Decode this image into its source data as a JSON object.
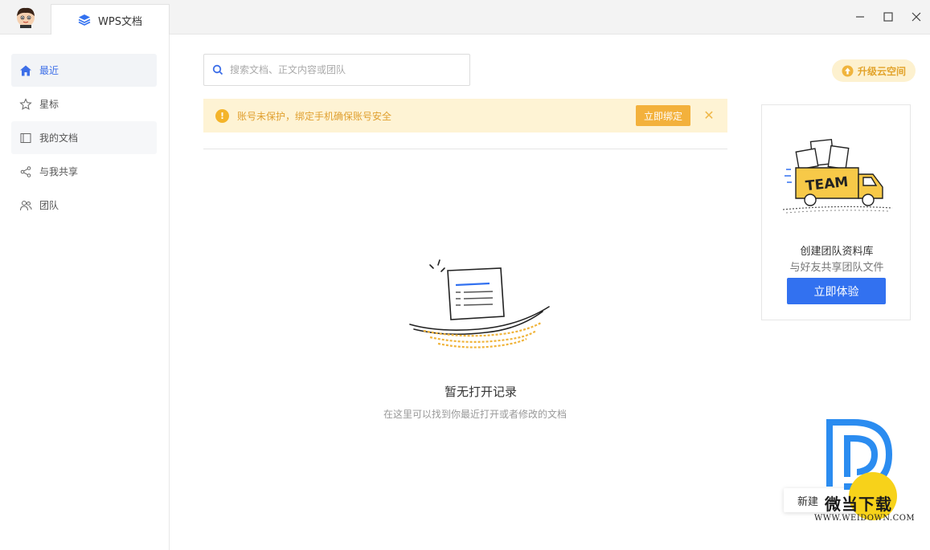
{
  "tab": {
    "title": "WPS文档"
  },
  "sidebar": {
    "items": [
      {
        "label": "最近",
        "icon": "home-icon",
        "active": true
      },
      {
        "label": "星标",
        "icon": "star-icon"
      },
      {
        "label": "我的文档",
        "icon": "folder-icon"
      },
      {
        "label": "与我共享",
        "icon": "share-icon"
      },
      {
        "label": "团队",
        "icon": "team-icon"
      }
    ]
  },
  "search": {
    "placeholder": "搜索文档、正文内容或团队"
  },
  "upgrade": {
    "label": "升级云空间"
  },
  "banner": {
    "message": "账号未保护，绑定手机确保账号安全",
    "button": "立即绑定",
    "close": "✕"
  },
  "empty": {
    "title": "暂无打开记录",
    "subtitle": "在这里可以找到你最近打开或者修改的文档"
  },
  "team_card": {
    "illustration_text": "TEAM",
    "title": "创建团队资料库",
    "subtitle": "与好友共享团队文件",
    "button": "立即体验"
  },
  "new_button": {
    "label": "新建"
  },
  "watermark": {
    "name": "微当下载",
    "url": "WWW.WEIDOWN.COM"
  },
  "colors": {
    "accent": "#3271f0",
    "warning": "#f3b13c",
    "active_nav": "#3d6fe8"
  }
}
